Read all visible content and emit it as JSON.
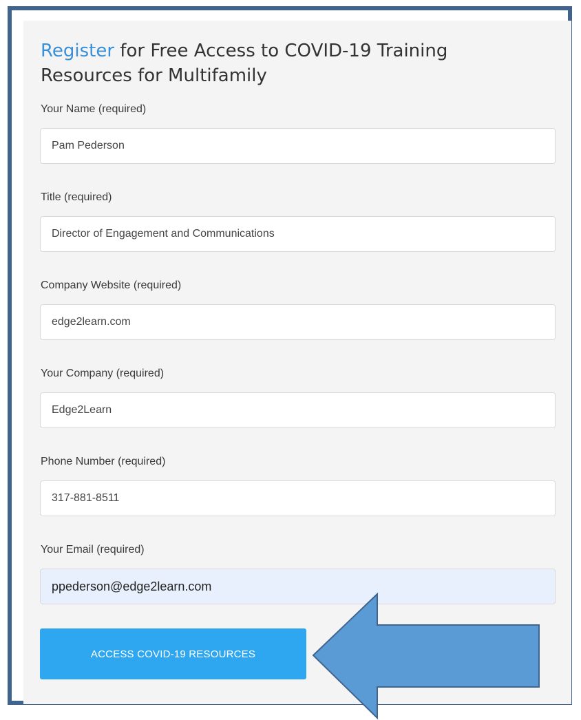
{
  "form": {
    "heading_link": "Register",
    "heading_rest": " for Free Access to COVID-19 Training Resources for Multifamily",
    "fields": [
      {
        "label": "Your Name (required)",
        "value": "Pam Pederson"
      },
      {
        "label": "Title (required)",
        "value": "Director of Engagement and Communications"
      },
      {
        "label": "Company Website (required)",
        "value": "edge2learn.com"
      },
      {
        "label": "Your Company (required)",
        "value": "Edge2Learn"
      },
      {
        "label": "Phone Number (required)",
        "value": "317-881-8511"
      },
      {
        "label": "Your Email (required)",
        "value": "ppederson@edge2learn.com"
      }
    ],
    "submit_label": "ACCESS COVID-19 RESOURCES"
  },
  "annotation": {
    "arrow_fill": "#5b9bd5",
    "arrow_stroke": "#41648f"
  },
  "colors": {
    "frame_border": "#41648f",
    "accent_link": "#3a8fd9",
    "button_bg": "#2ea6f0",
    "autofill_bg": "#e8f0fe",
    "panel_bg": "#f4f4f4"
  }
}
